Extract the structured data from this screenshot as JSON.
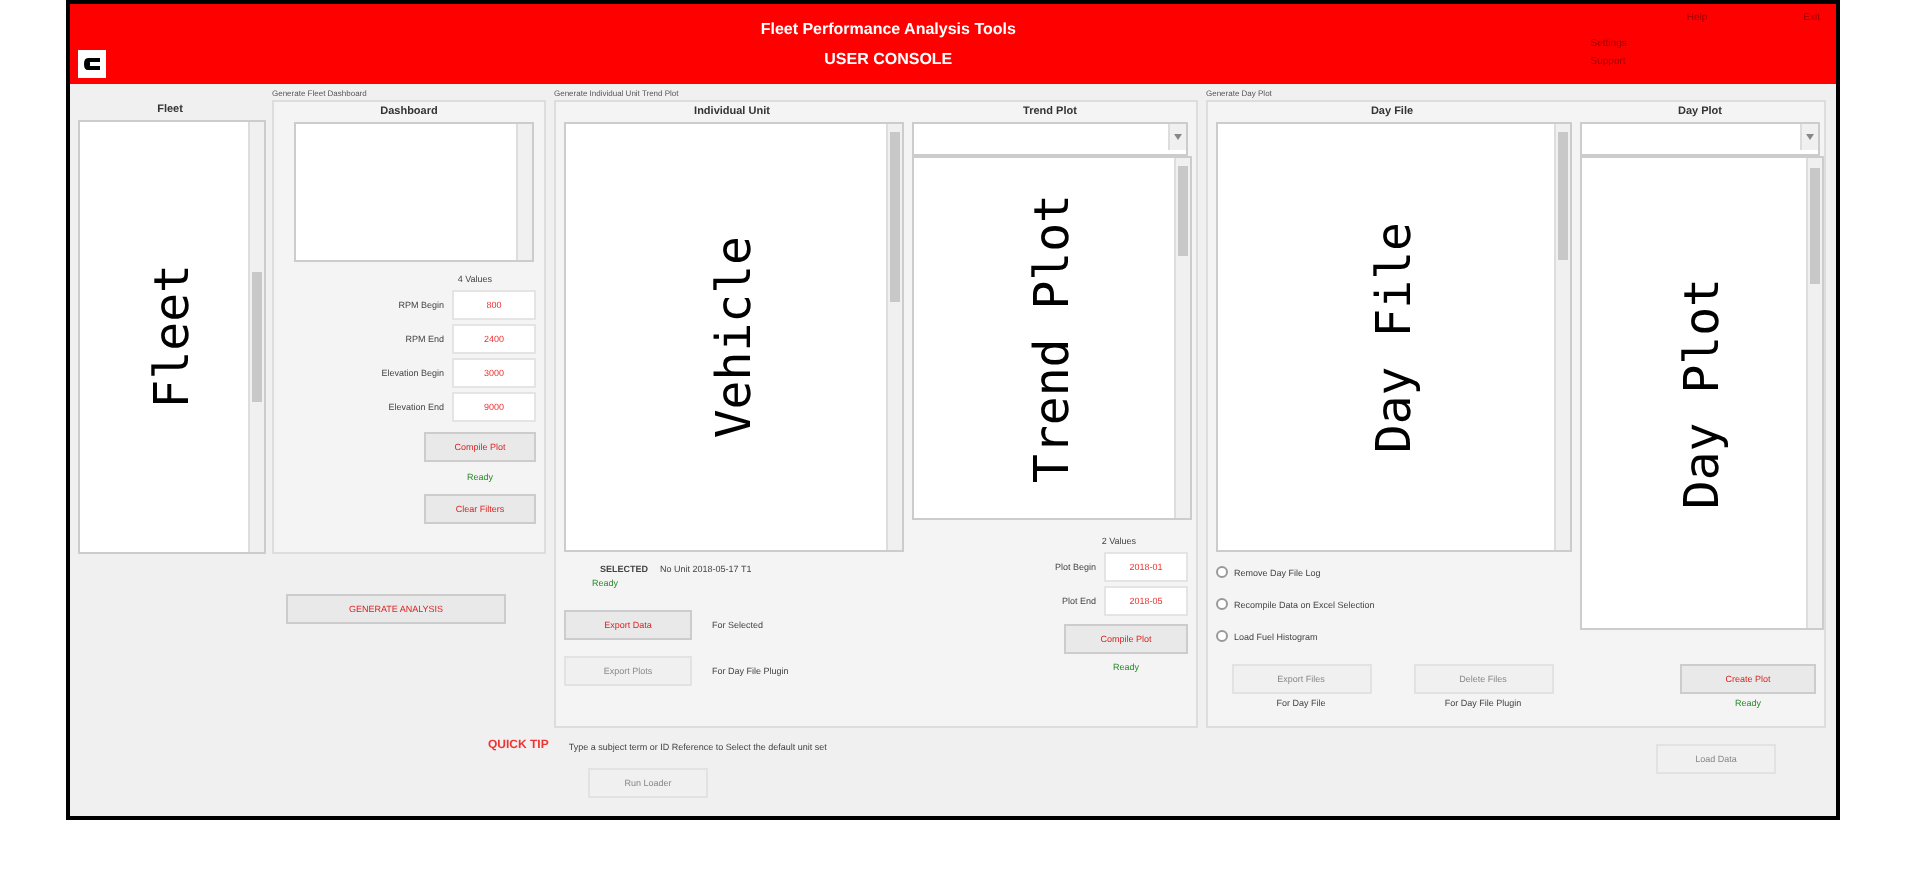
{
  "header": {
    "title": "Fleet Performance Analysis Tools",
    "subtitle": "USER CONSOLE",
    "links": [
      "Help",
      "Exit"
    ],
    "info": [
      "Settings",
      "Support"
    ]
  },
  "fleet": {
    "heading": "Fleet",
    "list_text": "Fleet"
  },
  "dashboard": {
    "group_label": "Generate Fleet Dashboard",
    "heading": "Dashboard",
    "values_label": "4 Values",
    "fields": [
      {
        "label": "RPM Begin",
        "value": "800"
      },
      {
        "label": "RPM End",
        "value": "2400"
      },
      {
        "label": "Elevation Begin",
        "value": "3000"
      },
      {
        "label": "Elevation End",
        "value": "9000"
      }
    ],
    "compile_button": {
      "label": "Compile Plot",
      "disabled": false
    },
    "status": "Ready",
    "clear_button": {
      "label": "Clear Filters",
      "disabled": false
    }
  },
  "generate_button": {
    "label": "GENERATE ANALYSIS",
    "disabled": false
  },
  "individual": {
    "group_label": "Generate Individual Unit Trend Plot",
    "heading": "Individual Unit",
    "list_text": "Vehicle",
    "selected_label": "SELECTED",
    "selected_value": "No Unit 2018-05-17 T1",
    "status": "Ready",
    "actions": [
      {
        "button": {
          "label": "Export Data",
          "disabled": false
        },
        "note": "For Selected"
      },
      {
        "button": {
          "label": "Export Plots",
          "disabled": true
        },
        "note": "For Day File Plugin"
      }
    ]
  },
  "trend": {
    "heading": "Trend Plot",
    "list_text": "Trend Plot",
    "values_label": "2 Values",
    "fields": [
      {
        "label": "Plot Begin",
        "value": "2018-01"
      },
      {
        "label": "Plot End",
        "value": "2018-05"
      }
    ],
    "button": {
      "label": "Compile Plot",
      "disabled": false
    },
    "status": "Ready"
  },
  "day_file": {
    "group_label": "Generate Day Plot",
    "heading": "Day File",
    "list_text": "Day File",
    "options": [
      {
        "label": "Remove Day File Log",
        "checked": false
      },
      {
        "label": "Recompile Data on Excel Selection",
        "checked": false
      },
      {
        "label": "Load Fuel Histogram",
        "checked": false
      }
    ],
    "actions": [
      {
        "button": {
          "label": "Export Files",
          "disabled": true
        },
        "note": "For Day File"
      },
      {
        "button": {
          "label": "Delete Files",
          "disabled": true
        },
        "note": "For Day File Plugin"
      }
    ]
  },
  "day_plot": {
    "heading": "Day Plot",
    "list_text": "Day Plot",
    "button": {
      "label": "Create Plot",
      "disabled": false
    },
    "status": "Ready"
  },
  "quick_tip": {
    "label": "QUICK TIP",
    "text": "Type a subject term or ID Reference to Select the default unit set"
  },
  "bottom_buttons": [
    {
      "label": "Run Loader",
      "disabled": true
    },
    {
      "label": "Load Data",
      "disabled": true
    }
  ]
}
